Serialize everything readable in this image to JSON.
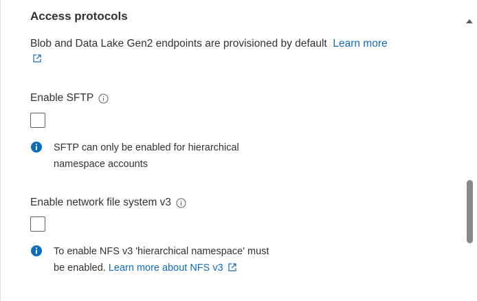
{
  "section": {
    "title": "Access protocols",
    "description": "Blob and Data Lake Gen2 endpoints are provisioned by default",
    "learn_more": "Learn more"
  },
  "sftp": {
    "label": "Enable SFTP",
    "checked": false,
    "note": "SFTP can only be enabled for hierarchical namespace accounts"
  },
  "nfs": {
    "label": "Enable network file system v3",
    "checked": false,
    "note_prefix": "To enable NFS v3 'hierarchical namespace' must be enabled.",
    "note_link": "Learn more about NFS v3"
  },
  "icons": {
    "info": "info-circle-icon",
    "info_filled": "info-filled-icon",
    "external": "external-link-icon",
    "scroll_up": "chevron-up-icon"
  },
  "colors": {
    "link": "#0f6cbd",
    "info_filled": "#0f6cbd",
    "text": "#323130",
    "scroll_thumb": "#8a8886"
  }
}
